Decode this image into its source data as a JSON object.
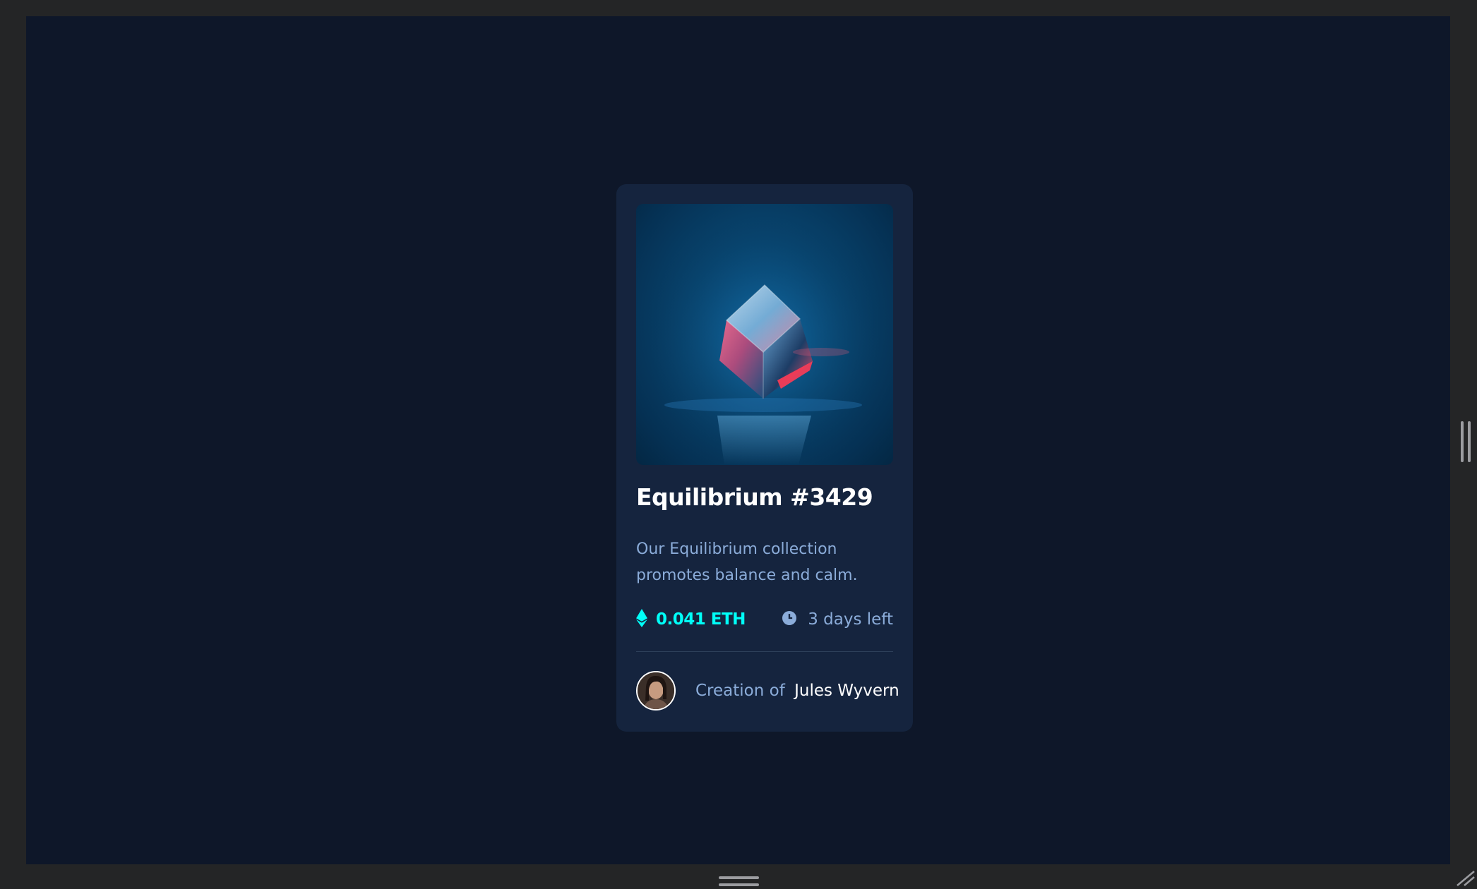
{
  "card": {
    "title": "Equilibrium #3429",
    "description": "Our Equilibrium collection promotes balance and calm.",
    "price": "0.041 ETH",
    "time_left": "3 days left",
    "creator_prefix": "Creation of",
    "creator_name": "Jules Wyvern",
    "icons": {
      "price": "ethereum-icon",
      "time": "clock-icon"
    }
  },
  "colors": {
    "page_background": "#0e1729",
    "card_background": "#15243e",
    "accent_cyan": "#00fff8",
    "soft_blue": "#8bacd9",
    "white": "#ffffff",
    "divider": "#2e405a"
  }
}
